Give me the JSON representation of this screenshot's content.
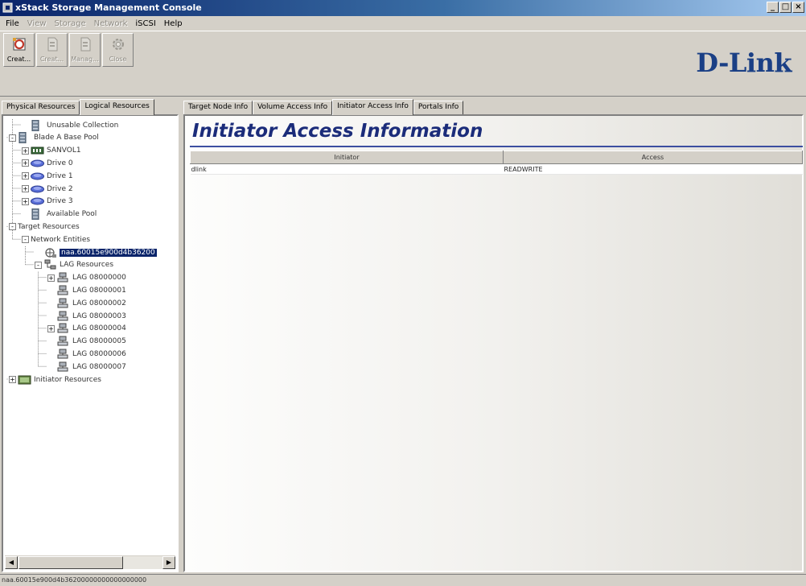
{
  "window": {
    "title": "xStack Storage Management Console",
    "buttons": [
      "_",
      "□",
      "×"
    ]
  },
  "menu": [
    {
      "label": "File",
      "enabled": true
    },
    {
      "label": "View",
      "enabled": false
    },
    {
      "label": "Storage",
      "enabled": false
    },
    {
      "label": "Network",
      "enabled": false
    },
    {
      "label": "iSCSI",
      "enabled": true
    },
    {
      "label": "Help",
      "enabled": true
    }
  ],
  "toolbar": {
    "buttons": [
      {
        "label": "Creat...",
        "icon": "create-icon",
        "enabled": true
      },
      {
        "label": "Creat...",
        "icon": "document-icon",
        "enabled": false
      },
      {
        "label": "Manag...",
        "icon": "document-icon",
        "enabled": false
      },
      {
        "label": "Close",
        "icon": "gear-icon",
        "enabled": false
      }
    ]
  },
  "logo": "D-Link",
  "left_tabs": [
    "Physical Resources",
    "Logical Resources"
  ],
  "tree": [
    {
      "label": "Unusable Collection",
      "depth": 1,
      "icon": "storage-pool-icon",
      "expander": ""
    },
    {
      "label": "Blade A Base Pool",
      "depth": 0,
      "icon": "storage-pool-icon",
      "expander": "-"
    },
    {
      "label": "SANVOL1",
      "depth": 1,
      "icon": "volume-icon",
      "expander": "+"
    },
    {
      "label": "Drive 0",
      "depth": 1,
      "icon": "drive-icon",
      "expander": "+"
    },
    {
      "label": "Drive 1",
      "depth": 1,
      "icon": "drive-icon",
      "expander": "+"
    },
    {
      "label": "Drive 2",
      "depth": 1,
      "icon": "drive-icon",
      "expander": "+"
    },
    {
      "label": "Drive 3",
      "depth": 1,
      "icon": "drive-icon",
      "expander": "+"
    },
    {
      "label": "Available Pool",
      "depth": 1,
      "icon": "storage-pool-icon",
      "expander": ""
    },
    {
      "label": "Target Resources",
      "depth": 0,
      "icon": "",
      "expander": "-"
    },
    {
      "label": "Network Entities",
      "depth": 1,
      "icon": "",
      "expander": "-"
    },
    {
      "label": "naa.60015e900d4b36200",
      "depth": 2,
      "icon": "network-entity-icon",
      "expander": "",
      "selected": true
    },
    {
      "label": "LAG Resources",
      "depth": 2,
      "icon": "network-group-icon",
      "expander": "-"
    },
    {
      "label": "LAG 08000000",
      "depth": 3,
      "icon": "network-node-icon",
      "expander": "+"
    },
    {
      "label": "LAG 08000001",
      "depth": 3,
      "icon": "network-node-icon",
      "expander": ""
    },
    {
      "label": "LAG 08000002",
      "depth": 3,
      "icon": "network-node-icon",
      "expander": ""
    },
    {
      "label": "LAG 08000003",
      "depth": 3,
      "icon": "network-node-icon",
      "expander": ""
    },
    {
      "label": "LAG 08000004",
      "depth": 3,
      "icon": "network-node-icon",
      "expander": "+"
    },
    {
      "label": "LAG 08000005",
      "depth": 3,
      "icon": "network-node-icon",
      "expander": ""
    },
    {
      "label": "LAG 08000006",
      "depth": 3,
      "icon": "network-node-icon",
      "expander": ""
    },
    {
      "label": "LAG 08000007",
      "depth": 3,
      "icon": "network-node-icon",
      "expander": ""
    },
    {
      "label": "Initiator Resources",
      "depth": 0,
      "icon": "initiator-icon",
      "expander": "+"
    }
  ],
  "right_tabs": [
    "Target Node Info",
    "Volume Access Info",
    "Initiator Access Info",
    "Portals Info"
  ],
  "active_right_tab": 2,
  "page_title": "Initiator Access Information",
  "table": {
    "columns": [
      "Initiator",
      "Access"
    ],
    "rows": [
      [
        "dlink",
        "READWRITE"
      ]
    ]
  },
  "status_text": "naa.60015e900d4b36200000000000000000",
  "colors": {
    "title_text": "#1b2c7a",
    "logo": "#1a3f85",
    "selection": "#0a246a"
  }
}
